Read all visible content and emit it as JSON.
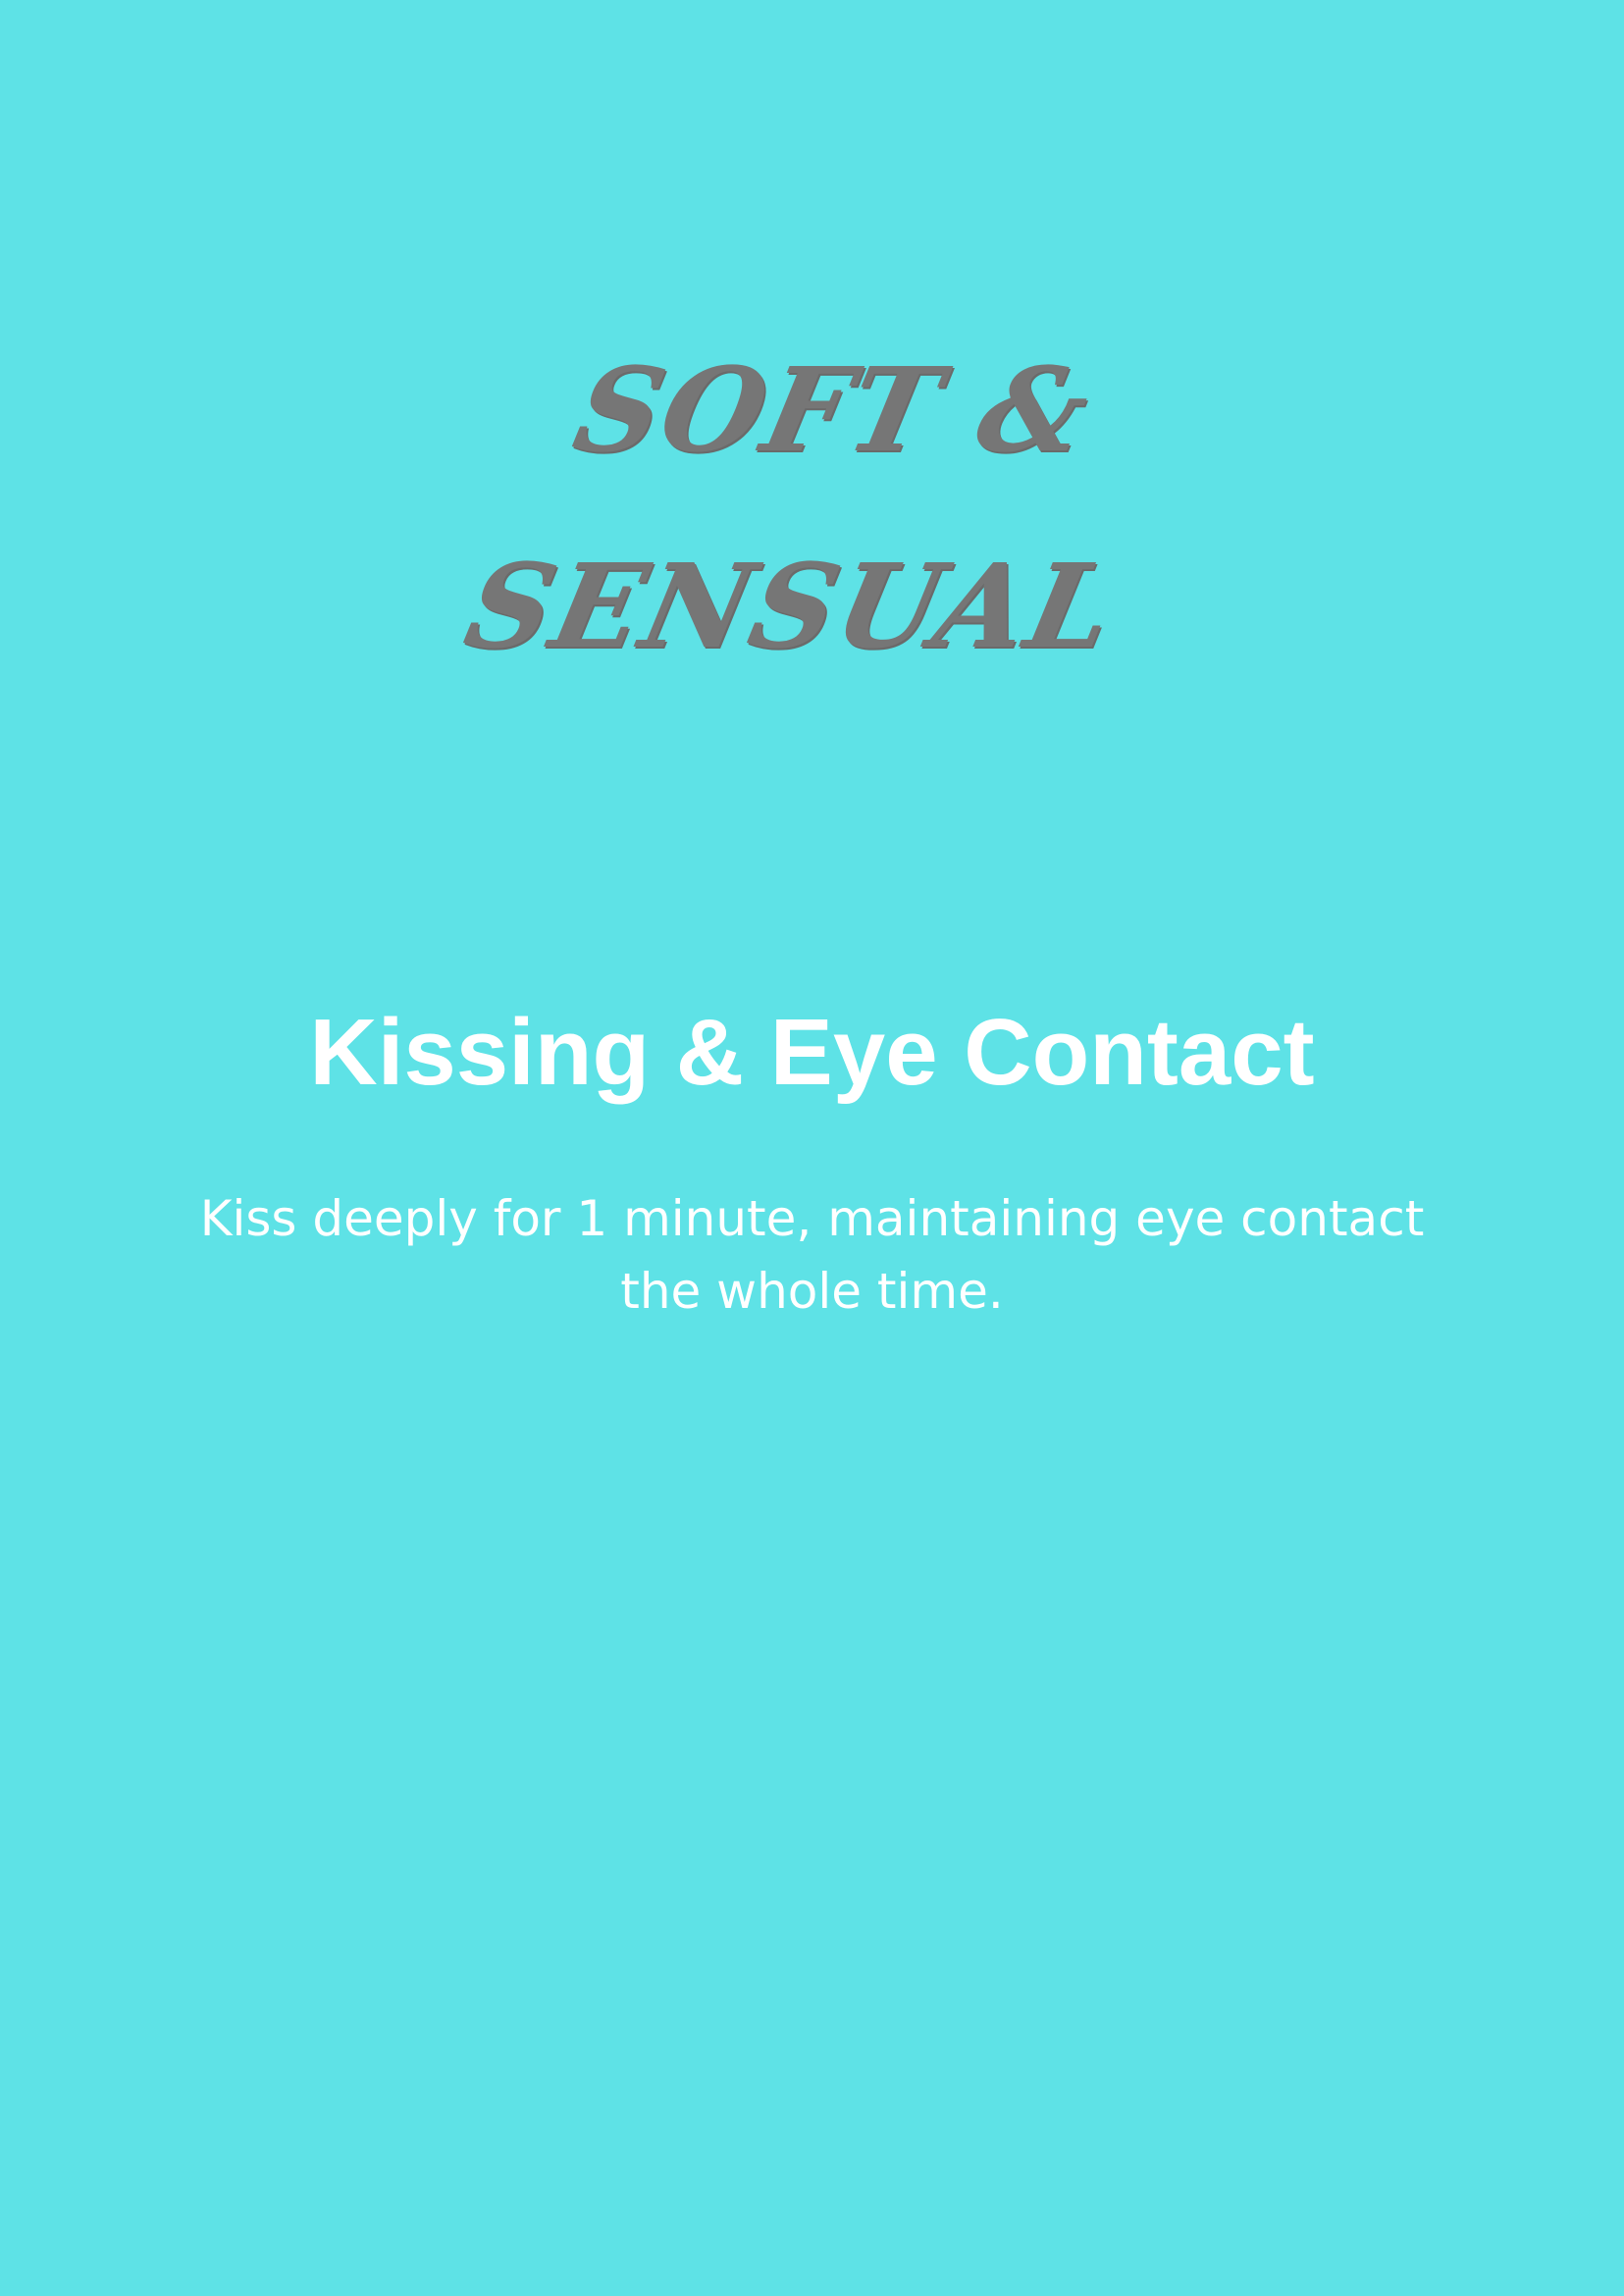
{
  "brand": {
    "line1": "SOFT &",
    "line2": "SENSUAL"
  },
  "card": {
    "title": "Kissing & Eye Contact",
    "body": "Kiss deeply for 1 minute, maintaining eye contact the whole time."
  },
  "colors": {
    "background": "#5ee2e6",
    "brand_text": "#767676",
    "card_text": "#ffffff"
  }
}
